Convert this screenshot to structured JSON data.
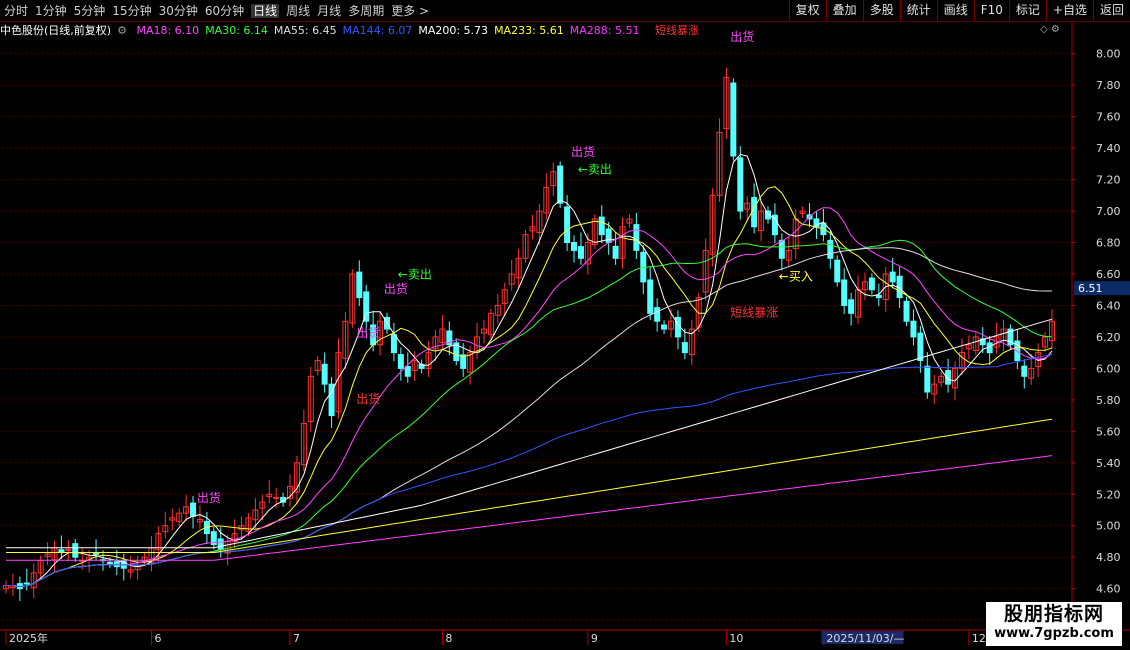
{
  "toolbar": {
    "periods": [
      "分时",
      "1分钟",
      "5分钟",
      "15分钟",
      "30分钟",
      "60分钟",
      "日线",
      "周线",
      "月线",
      "多周期",
      "更多 >"
    ],
    "active_period": "日线",
    "buttons": [
      "复权",
      "叠加",
      "多股",
      "统计",
      "画线",
      "F10",
      "标记",
      "+自选",
      "返回"
    ]
  },
  "info": {
    "stock": "中色股份(日线,前复权)",
    "ma": [
      {
        "label": "MA18: 6.10",
        "color": "#ff44ff"
      },
      {
        "label": "MA30: 6.14",
        "color": "#33ff33"
      },
      {
        "label": "MA55: 6.45",
        "color": "#dddddd"
      },
      {
        "label": "MA144: 6.07",
        "color": "#3355ff"
      },
      {
        "label": "MA200: 5.73",
        "color": "#ffffff"
      },
      {
        "label": "MA233: 5.61",
        "color": "#ffff33"
      },
      {
        "label": "MA288: 5.51",
        "color": "#ff33ff"
      }
    ],
    "signal": {
      "label": "短线暴涨",
      "color": "#ff3333"
    }
  },
  "colors": {
    "up": "#ff3232",
    "down": "#54ffff",
    "grid": "#5a0000",
    "axis": "#b00000",
    "tick": "#dddddd"
  },
  "chart_data": {
    "type": "candlestick",
    "ylim": [
      4.35,
      8.1
    ],
    "yticks": [
      4.4,
      4.6,
      4.8,
      5.0,
      5.2,
      5.4,
      5.6,
      5.8,
      6.0,
      6.2,
      6.4,
      6.6,
      6.8,
      7.0,
      7.2,
      7.4,
      7.6,
      7.8,
      8.0
    ],
    "y_tick_labels": [
      "4.40",
      "4.60",
      "4.80",
      "5.00",
      "5.20",
      "5.40",
      "5.60",
      "5.80",
      "6.00",
      "6.20",
      "6.40",
      "6.60",
      "6.80",
      "7.00",
      "7.20",
      "7.40",
      "7.60",
      "7.80",
      "8.00"
    ],
    "current_price": 6.51,
    "current_price_label": "6.51",
    "x_labels": [
      {
        "label": "2025年",
        "index": 0
      },
      {
        "label": "6",
        "index": 21
      },
      {
        "label": "7",
        "index": 41
      },
      {
        "label": "8",
        "index": 63
      },
      {
        "label": "9",
        "index": 84
      },
      {
        "label": "10",
        "index": 104
      },
      {
        "label": "2025/11/03/—",
        "index": 118
      },
      {
        "label": "12",
        "index": 139
      }
    ],
    "close": [
      4.62,
      4.62,
      4.6,
      4.63,
      4.7,
      4.78,
      4.82,
      4.86,
      4.83,
      4.85,
      4.8,
      4.78,
      4.8,
      4.82,
      4.78,
      4.76,
      4.74,
      4.73,
      4.72,
      4.75,
      4.8,
      4.86,
      4.95,
      5.0,
      5.05,
      5.08,
      5.12,
      5.06,
      5.04,
      4.95,
      4.88,
      4.85,
      4.9,
      4.95,
      5.0,
      5.05,
      5.1,
      5.15,
      5.2,
      5.18,
      5.15,
      5.25,
      5.4,
      5.65,
      5.95,
      6.05,
      5.9,
      5.7,
      6.1,
      6.3,
      6.6,
      6.45,
      6.3,
      6.15,
      6.3,
      6.25,
      6.1,
      6.0,
      5.95,
      6.05,
      6.0,
      6.1,
      6.2,
      6.25,
      6.15,
      6.05,
      6.0,
      6.1,
      6.2,
      6.25,
      6.35,
      6.4,
      6.5,
      6.6,
      6.7,
      6.85,
      6.9,
      7.0,
      7.15,
      7.25,
      7.05,
      6.8,
      6.75,
      6.7,
      6.8,
      6.95,
      6.85,
      6.8,
      6.7,
      6.9,
      6.95,
      6.75,
      6.55,
      6.35,
      6.3,
      6.25,
      6.3,
      6.2,
      6.1,
      6.25,
      6.45,
      6.75,
      7.1,
      7.5,
      7.85,
      7.35,
      7.0,
      7.05,
      6.9,
      7.0,
      6.95,
      6.85,
      6.7,
      6.75,
      6.95,
      7.0,
      6.95,
      6.9,
      6.85,
      6.7,
      6.55,
      6.4,
      6.35,
      6.5,
      6.55,
      6.5,
      6.45,
      6.6,
      6.55,
      6.45,
      6.3,
      6.2,
      6.05,
      5.85,
      5.9,
      5.95,
      5.9,
      6.0,
      6.1,
      6.15,
      6.2,
      6.15,
      6.1,
      6.2,
      6.25,
      6.15,
      6.05,
      5.95,
      6.0,
      6.1,
      6.2,
      6.3
    ],
    "annotations": [
      {
        "text": "出货",
        "index": 29,
        "price": 5.15,
        "color": "#ff44ff"
      },
      {
        "text": "出货",
        "index": 52,
        "price": 6.2,
        "color": "#ff44ff"
      },
      {
        "text": "出货",
        "index": 56,
        "price": 6.48,
        "color": "#ff44ff"
      },
      {
        "text": "←卖出",
        "index": 58,
        "price": 6.57,
        "color": "#33ff33"
      },
      {
        "text": "出货",
        "index": 83,
        "price": 7.35,
        "color": "#ff44ff"
      },
      {
        "text": "←卖出",
        "index": 84,
        "price": 7.24,
        "color": "#33ff33"
      },
      {
        "text": "出货",
        "index": 106,
        "price": 8.08,
        "color": "#ff44ff"
      },
      {
        "text": "←买入",
        "index": 113,
        "price": 6.56,
        "color": "#ffff33"
      },
      {
        "text": "短线暴涨",
        "index": 106,
        "price": 6.33,
        "color": "#ff3333"
      },
      {
        "text": "出货",
        "index": 52,
        "price": 5.78,
        "color": "#ff3333"
      }
    ]
  },
  "watermark": {
    "line1": "股朋指标网",
    "line2": "www.7gpzb.com"
  }
}
